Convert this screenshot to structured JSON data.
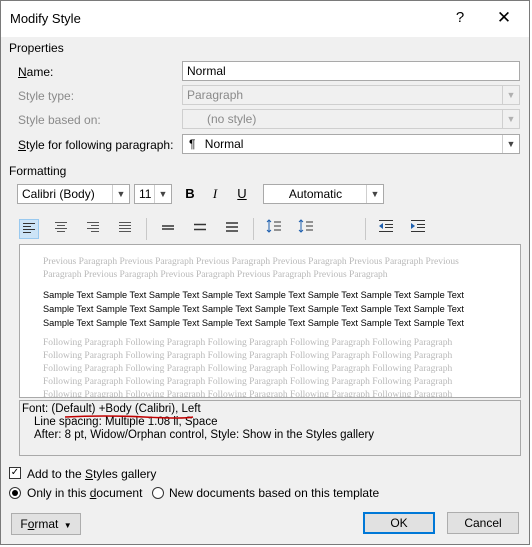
{
  "window": {
    "title": "Modify Style",
    "help_label": "?",
    "close_label": "✕"
  },
  "properties": {
    "section_label": "Properties",
    "name_label": "Name:",
    "name_value": "Normal",
    "style_type_label": "Style type:",
    "style_type_value": "Paragraph",
    "based_on_label": "Style based on:",
    "based_on_value": "(no style)",
    "following_label": "Style for following paragraph:",
    "following_icon": "¶",
    "following_value": "Normal"
  },
  "formatting": {
    "section_label": "Formatting",
    "font_value": "Calibri (Body)",
    "size_value": "11",
    "bold_label": "B",
    "italic_label": "I",
    "underline_label": "U",
    "color_value": "Automatic",
    "colors": {
      "accent": "#0078d7",
      "selected_bg": "#cce4f7",
      "annotation_red": "#c00000"
    }
  },
  "preview": {
    "previous_text": "Previous Paragraph Previous Paragraph Previous Paragraph Previous Paragraph Previous Paragraph Previous Paragraph Previous Paragraph Previous Paragraph Previous Paragraph Previous Paragraph",
    "sample_text": "Sample Text Sample Text Sample Text Sample Text Sample Text Sample Text Sample Text Sample Text Sample Text Sample Text Sample Text Sample Text Sample Text Sample Text Sample Text Sample Text Sample Text Sample Text Sample Text Sample Text Sample Text Sample Text Sample Text Sample Text",
    "following_text": "Following Paragraph Following Paragraph Following Paragraph Following Paragraph Following Paragraph Following Paragraph Following Paragraph Following Paragraph Following Paragraph Following Paragraph Following Paragraph Following Paragraph Following Paragraph Following Paragraph Following Paragraph Following Paragraph Following Paragraph Following Paragraph Following Paragraph Following Paragraph Following Paragraph Following Paragraph Following Paragraph Following Paragraph Following Paragraph Following Paragraph Following Paragraph Following Paragraph"
  },
  "description": {
    "line1": "Font: (Default) +Body (Calibri), Left",
    "line2": "Line spacing:  Multiple 1.08 li, Space",
    "line3": "After:  8 pt, Widow/Orphan control, Style: Show in the Styles gallery"
  },
  "options": {
    "add_to_gallery_label": "Add to the Styles gallery",
    "add_to_gallery_checked": true,
    "only_this_doc_label": "Only in this document",
    "new_docs_label": "New documents based on this template"
  },
  "buttons": {
    "format_label": "Format",
    "ok_label": "OK",
    "cancel_label": "Cancel"
  }
}
